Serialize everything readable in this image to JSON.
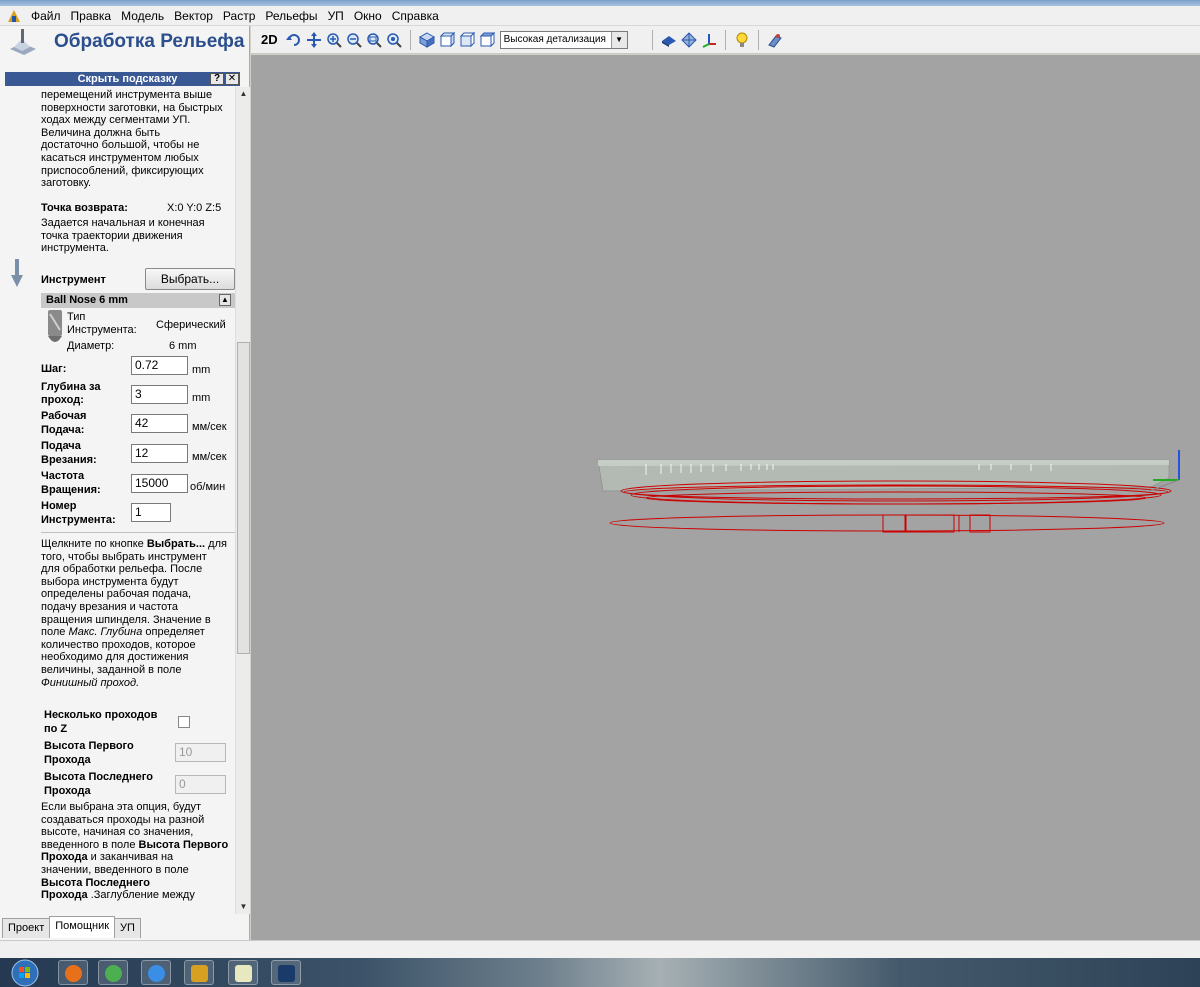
{
  "menubar": {
    "items": [
      "Файл",
      "Правка",
      "Модель",
      "Вектор",
      "Растр",
      "Рельефы",
      "УП",
      "Окно",
      "Справка"
    ]
  },
  "panel": {
    "title": "Обработка Рельефа",
    "hint_bar": {
      "label": "Скрыть подсказку",
      "help_btn": "?",
      "close_btn": "✕"
    },
    "intro_lines": [
      "перемещений инструмента выше",
      "поверхности заготовки, на быстрых",
      "ходах между сегментами УП.",
      "Величина должна быть",
      "достаточно большой, чтобы не",
      "касаться инструментом любых",
      "приспособлений, фиксирующих",
      "заготовку."
    ],
    "return_point": {
      "label": "Точка возврата:",
      "value": "X:0 Y:0 Z:5"
    },
    "return_desc_lines": [
      "Задается начальная и конечная",
      "точка траектории движения",
      "инструмента."
    ],
    "tool": {
      "label": "Инструмент",
      "select_button": "Выбрать...",
      "name": "Ball Nose 6 mm",
      "collapse": "▲",
      "type_label_1": "Тип",
      "type_label_2": "Инструмента:",
      "type_value": "Сферический",
      "diameter_label": "Диаметр:",
      "diameter_value": "6 mm"
    },
    "params": {
      "step": {
        "label": "Шаг:",
        "value": "0.72",
        "unit": "mm"
      },
      "depth": {
        "label_1": "Глубина за",
        "label_2": "проход:",
        "value": "3",
        "unit": "mm"
      },
      "feed": {
        "label_1": "Рабочая",
        "label_2": "Подача:",
        "value": "42",
        "unit": "мм/сек"
      },
      "plunge": {
        "label_1": "Подача",
        "label_2": "Врезания:",
        "value": "12",
        "unit": "мм/сек"
      },
      "spindle": {
        "label_1": "Частота",
        "label_2": "Вращения:",
        "value": "15000",
        "unit": "об/мин"
      },
      "tool_number": {
        "label_1": "Номер",
        "label_2": "Инструмента:",
        "value": "1"
      }
    },
    "help_lines": [
      {
        "pre": "Щелкните по кнопке ",
        "bold": "Выбрать...",
        "post": " для"
      },
      {
        "pre": "того, чтобы выбрать инструмент"
      },
      {
        "pre": "для обработки рельефа. После"
      },
      {
        "pre": "выбора инструмента будут"
      },
      {
        "pre": "определены рабочая подача,"
      },
      {
        "pre": "подачу врезания и частота"
      },
      {
        "pre": "вращения шпинделя. Значение в"
      },
      {
        "pre": "поле ",
        "italic": "Макс. Глубина",
        "post": " определяет"
      },
      {
        "pre": "количество проходов, которое"
      },
      {
        "pre": "необходимо для достижения"
      },
      {
        "pre": "величины, заданной в поле"
      },
      {
        "italic": "Финишный проход."
      }
    ],
    "multipass": {
      "label_1": "Несколько проходов",
      "label_2": "по Z",
      "first_label_1": "Высота Первого",
      "first_label_2": "Прохода",
      "first_value": "10",
      "last_label_1": "Высота Последнего",
      "last_label_2": "Прохода",
      "last_value": "0"
    },
    "multipass_help_lines": [
      {
        "pre": "Если выбрана эта опция, будут"
      },
      {
        "pre": "создаваться проходы на разной"
      },
      {
        "pre": "высоте, начиная со значения,"
      },
      {
        "pre": "введенного в поле ",
        "bold": "Высота Первого"
      },
      {
        "bold": "Прохода",
        "post": " и заканчивая на"
      },
      {
        "pre": "значении, введенного в поле"
      },
      {
        "bold": "Высота Последнего"
      },
      {
        "bold": "Прохода",
        "post": " .Заглубление между"
      }
    ],
    "tabs": [
      "Проект",
      "Помощник",
      "УП"
    ]
  },
  "toolbar": {
    "mode_2d": "2D",
    "detail_value": "Высокая детализация"
  },
  "colors": {
    "accent": "#2b4f8c",
    "hint_bar": "#3a5894",
    "viewport_bg": "#a3a3a3",
    "toolpath": "#cc0000"
  }
}
